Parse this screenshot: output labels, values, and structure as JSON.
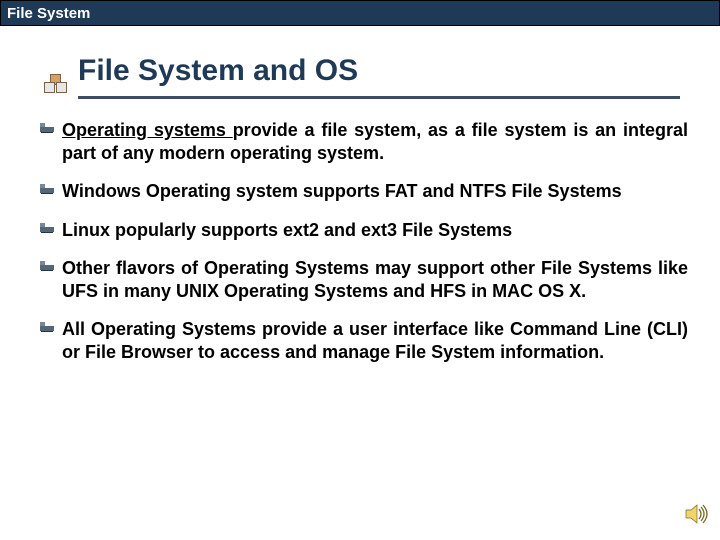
{
  "header": {
    "title": "File System"
  },
  "title": "File System and OS",
  "bullets": [
    {
      "link": "Operating systems ",
      "rest": "provide a file system, as a file system is an integral part of any modern operating system."
    },
    {
      "text": "Windows Operating system supports FAT and NTFS File Systems"
    },
    {
      "text": "Linux popularly supports ext2 and ext3 File Systems"
    },
    {
      "text": "Other flavors of Operating Systems may support other File Systems like UFS in many UNIX Operating Systems and HFS in MAC OS X."
    },
    {
      "text": "All Operating Systems provide a user interface like Command Line (CLI) or File Browser to access and manage File System information."
    }
  ]
}
